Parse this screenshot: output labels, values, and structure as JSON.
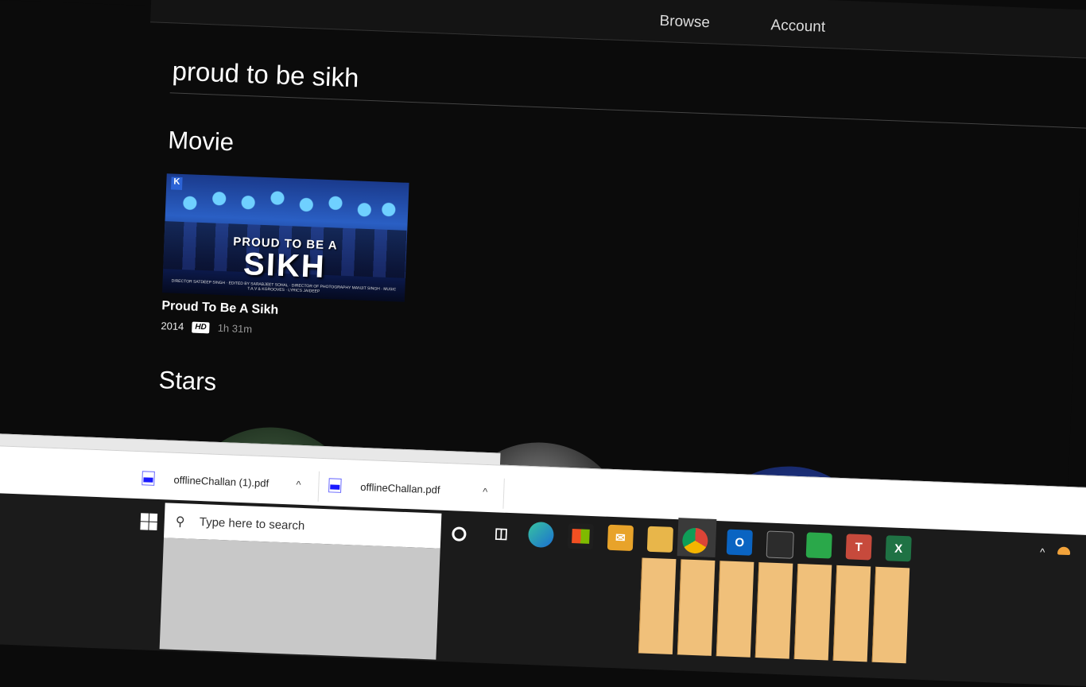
{
  "topnav": {
    "browse": "Browse",
    "account": "Account"
  },
  "search": {
    "query": "proud to be sikh"
  },
  "sections": {
    "movie": "Movie",
    "stars": "Stars"
  },
  "movie": {
    "poster_brand": "K",
    "poster_line1": "PROUD TO BE A",
    "poster_line2": "SIKH",
    "poster_credits": "DIRECTOR SATDEEP SINGH · EDITED BY SARABJEET SOHAL · DIRECTOR OF PHOTOGRAPHY MANJIT SINGH · MUSIC T.A.V & KGROOVES · LYRICS JAIDEEP",
    "title": "Proud To Be A Sikh",
    "year": "2014",
    "badge": "HD",
    "duration": "1h 31m"
  },
  "status_url": "https://spuul.com/search",
  "downloads": [
    {
      "name": "offlineChallan (1).pdf",
      "icon": "pdf-icon"
    },
    {
      "name": "offlineChallan.pdf",
      "icon": "pdf-icon"
    }
  ],
  "taskbar": {
    "search_placeholder": "Type here to search",
    "apps": [
      "cortana",
      "task-view",
      "edge",
      "microsoft-store",
      "mail",
      "file-explorer",
      "chrome",
      "outlook",
      "command-prompt",
      "notepad",
      "teams",
      "excel"
    ]
  },
  "colors": {
    "background": "#0b0b0b",
    "download_bar": "#ffffff",
    "taskbar": "#1b1b1b",
    "accent_thumbs": "#f0c07a"
  }
}
